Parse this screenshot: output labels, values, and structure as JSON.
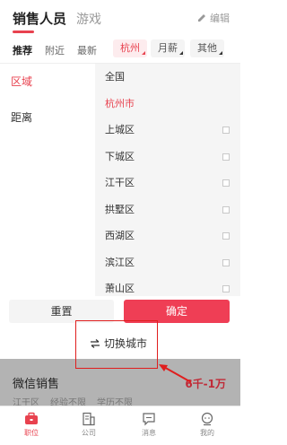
{
  "top_tabs": {
    "sales_label": "销售人员",
    "game_label": "游戏",
    "edit_label": "编辑"
  },
  "filter_bar": {
    "recommend": "推荐",
    "nearby": "附近",
    "latest": "最新",
    "chips": {
      "city": "杭州",
      "salary": "月薪",
      "other": "其他"
    }
  },
  "left_menu": [
    {
      "label": "区域"
    },
    {
      "label": "距离"
    }
  ],
  "right_menu": [
    {
      "label": "全国"
    },
    {
      "label": "杭州市"
    },
    {
      "label": "上城区"
    },
    {
      "label": "下城区"
    },
    {
      "label": "江干区"
    },
    {
      "label": "拱墅区"
    },
    {
      "label": "西湖区"
    },
    {
      "label": "滨江区"
    },
    {
      "label": "萧山区"
    }
  ],
  "actions": {
    "reset": "重置",
    "confirm": "确定"
  },
  "switch_city": {
    "label": "切换城市"
  },
  "job_card": {
    "title": "微信销售",
    "salary": "6千-1万",
    "tags": [
      "江干区",
      "经验不限",
      "学历不限"
    ]
  },
  "bottom_nav": {
    "position": "职位",
    "company": "公司",
    "message": "消息",
    "mine": "我的"
  },
  "colors": {
    "accent": "#e8424f",
    "confirm": "#ef3e55",
    "annotation": "#e01e1e"
  }
}
